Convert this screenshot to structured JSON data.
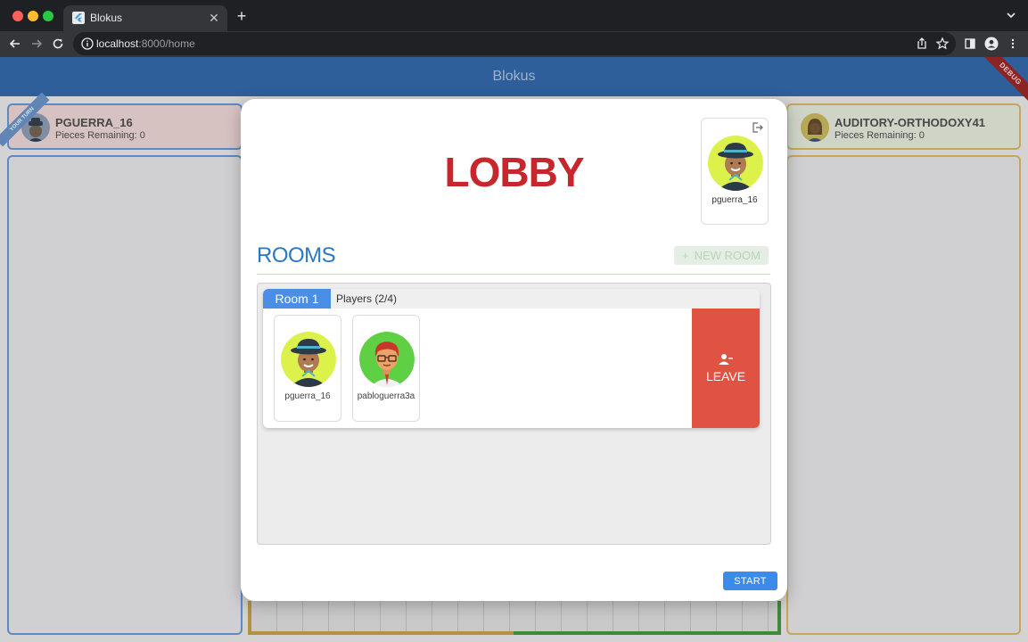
{
  "browser": {
    "tab_title": "Blokus",
    "url_host": "localhost",
    "url_rest": ":8000/home"
  },
  "app": {
    "title": "Blokus",
    "debug_label": "DEBUG",
    "turn_label": "YOUR TURN"
  },
  "players": [
    {
      "name": "PGUERRA_16",
      "pieces": "Pieces Remaining: 0"
    },
    {
      "name": "AUDITORY-ORTHODOXY41",
      "pieces": "Pieces Remaining: 0"
    }
  ],
  "lobby": {
    "title": "LOBBY",
    "current_user": "pguerra_16",
    "rooms_title": "ROOMS",
    "new_room_label": "NEW ROOM",
    "start_label": "START"
  },
  "rooms": [
    {
      "name": "Room 1",
      "players_label": "Players (2/4)",
      "leave_label": "LEAVE",
      "players": [
        {
          "name": "pguerra_16"
        },
        {
          "name": "pabloguerra3a"
        }
      ]
    }
  ],
  "colors": {
    "accent_blue": "#2b78c4",
    "lobby_red": "#c8262d",
    "leave_red": "#e05242",
    "start_blue": "#3c8be8",
    "avatar_yellow": "#dcf24a",
    "avatar_green": "#5fcf44"
  }
}
